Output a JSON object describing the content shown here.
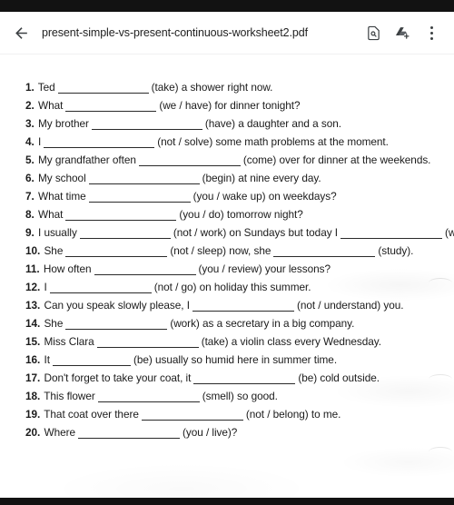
{
  "window": {
    "app": "pdf-viewer",
    "status_bar_color": "#121212"
  },
  "appbar": {
    "back_label": "←",
    "title": "present-simple-vs-present-continuous-worksheet2.pdf",
    "icons": {
      "back": "back-arrow-icon",
      "find": "find-in-page-icon",
      "save_to_drive": "google-drive-add-icon",
      "overflow": "more-options-icon"
    }
  },
  "document": {
    "questions": [
      {
        "num": "1.",
        "pre": "Ted",
        "blank": "b-l",
        "post": "(take) a shower right now."
      },
      {
        "num": "2.",
        "pre": "What",
        "blank": "b-l",
        "post": "(we / have) for dinner tonight?"
      },
      {
        "num": "3.",
        "pre": "My brother",
        "blank": "b-xxl",
        "post": "(have) a daughter and a son."
      },
      {
        "num": "4.",
        "pre": "I",
        "blank": "b-xxl",
        "post": "(not / solve) some math problems at the moment."
      },
      {
        "num": "5.",
        "pre": "My grandfather often",
        "blank": "b-xl",
        "post": "(come) over for dinner at the weekends."
      },
      {
        "num": "6.",
        "pre": "My school",
        "blank": "b-xxl",
        "post": "(begin) at nine every day."
      },
      {
        "num": "7.",
        "pre": "What time",
        "blank": "b-xl",
        "post": "(you / wake up) on weekdays?"
      },
      {
        "num": "8.",
        "pre": "What",
        "blank": "b-xxl",
        "post": "(you / do) tomorrow night?"
      },
      {
        "num": "9.",
        "pre": "I usually",
        "blank": "b-l",
        "post": "(not / work) on Sundays but today I",
        "blank2": "b-xl",
        "post2": "(work)."
      },
      {
        "num": "10.",
        "pre": "She",
        "blank": "b-xl",
        "post": "(not / sleep) now, she",
        "blank2": "b-xl",
        "post2": "(study)."
      },
      {
        "num": "11.",
        "pre": "How often",
        "blank": "b-xl",
        "post": "(you / review) your lessons?"
      },
      {
        "num": "12.",
        "pre": "I",
        "blank": "b-xl",
        "post": "(not / go) on holiday this summer."
      },
      {
        "num": "13.",
        "pre": "Can you speak slowly please, I",
        "blank": "b-xl",
        "post": "(not / understand) you."
      },
      {
        "num": "14.",
        "pre": "She",
        "blank": "b-xl",
        "post": "(work) as a secretary in a big company."
      },
      {
        "num": "15.",
        "pre": "Miss Clara",
        "blank": "b-xl",
        "post": "(take) a violin class every Wednesday."
      },
      {
        "num": "16.",
        "pre": "It",
        "blank": "b-m",
        "post": "(be) usually so humid here in summer time."
      },
      {
        "num": "17.",
        "pre": "Don't forget to take your coat, it",
        "blank": "b-xl",
        "post": "(be) cold outside."
      },
      {
        "num": "18.",
        "pre": "This flower",
        "blank": "b-xl",
        "post": "(smell) so good."
      },
      {
        "num": "19.",
        "pre": "That coat over there",
        "blank": "b-xl",
        "post": "(not / belong) to me."
      },
      {
        "num": "20.",
        "pre": "Where",
        "blank": "b-xl",
        "post": "(you / live)?"
      }
    ]
  }
}
